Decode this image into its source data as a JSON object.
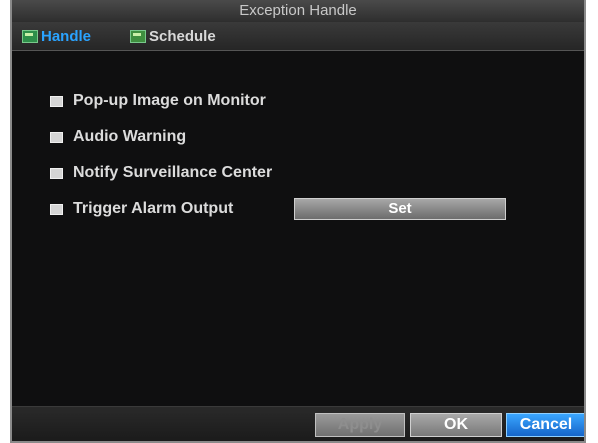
{
  "window": {
    "title": "Exception Handle"
  },
  "tabs": [
    {
      "label": "Handle",
      "active": true
    },
    {
      "label": "Schedule",
      "active": false
    }
  ],
  "options": [
    {
      "label": "Pop-up Image on Monitor",
      "checked": false
    },
    {
      "label": "Audio Warning",
      "checked": false
    },
    {
      "label": "Notify Surveillance Center",
      "checked": false
    },
    {
      "label": "Trigger Alarm Output",
      "checked": false
    }
  ],
  "set_button": {
    "label": "Set"
  },
  "footer": {
    "apply_label": "Apply",
    "ok_label": "OK",
    "cancel_label": "Cancel"
  },
  "colors": {
    "active_tab": "#2aa3ff",
    "cancel_button": "#1f7fe0",
    "background": "#0f0f10"
  }
}
